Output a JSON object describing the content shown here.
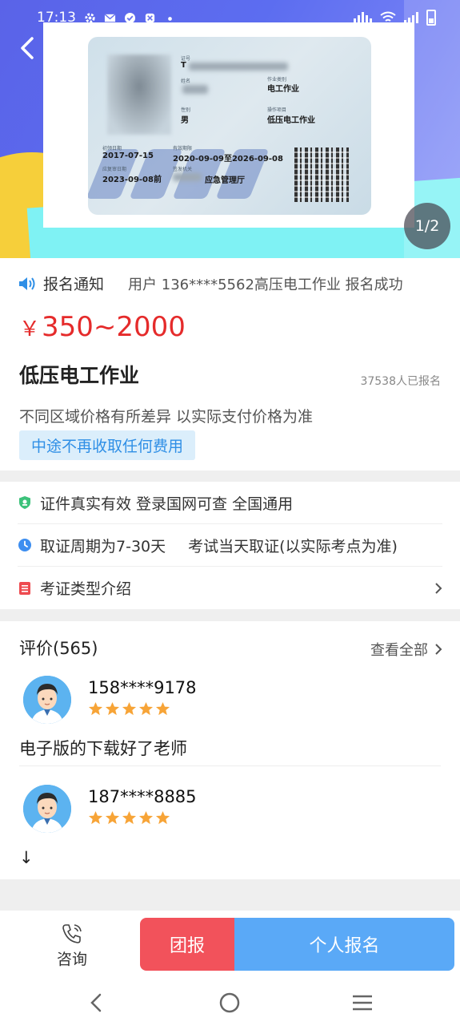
{
  "status_bar": {
    "time": "17:13"
  },
  "banner": {
    "pager": "1/2"
  },
  "certificate": {
    "id_label": "证号",
    "id_prefix": "T",
    "name_label": "姓名",
    "gender_label": "性别",
    "gender": "男",
    "category_label": "作业类别",
    "category": "电工作业",
    "item_label": "操作项目",
    "item": "低压电工作业",
    "first_issue_label": "初领日期",
    "first_issue": "2017-07-15",
    "validity_label": "有效期限",
    "validity": "2020-09-09至2026-09-08",
    "review_label": "应复审日期",
    "review_date": "2023-09-08前",
    "issuer_label": "签发机关",
    "issuer": "应急管理厅"
  },
  "notice": {
    "title": "报名通知",
    "text": "用户 136****5562高压电工作业  报名成功"
  },
  "product": {
    "currency": "￥",
    "price": "350~2000",
    "name": "低压电工作业",
    "enrolled": "37538人已报名",
    "price_note": "不同区域价格有所差异  以实际支付价格为准",
    "no_fee": "中途不再收取任何费用"
  },
  "features": {
    "f1": "证件真实有效 登录国网可查 全国通用",
    "f2a": "取证周期为7-30天",
    "f2b": "考试当天取证(以实际考点为准)",
    "f3": "考证类型介绍"
  },
  "reviews": {
    "title": "评价(565)",
    "view_all": "查看全部",
    "items": [
      {
        "user": "158****9178",
        "rating": 5,
        "text": "电子版的下载好了老师"
      },
      {
        "user": "187****8885",
        "rating": 5,
        "text": "↓"
      }
    ]
  },
  "bottom_bar": {
    "consult": "咨询",
    "group_signup": "团报",
    "personal_signup": "个人报名"
  },
  "colors": {
    "price": "#e52b2b",
    "accent_blue": "#5aa9f7",
    "group_red": "#f2525b",
    "star": "#f7a437"
  }
}
